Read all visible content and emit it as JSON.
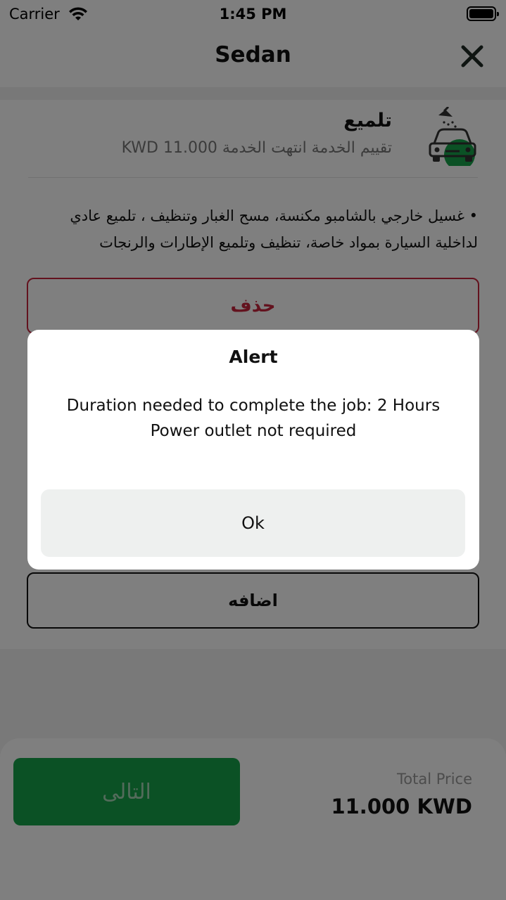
{
  "status_bar": {
    "carrier": "Carrier",
    "time": "1:45 PM"
  },
  "nav": {
    "title": "Sedan",
    "close_icon": "close-icon"
  },
  "service": {
    "name": "تلميع",
    "meta": "تقييم الخدمة انتهت الخدمة KWD 11.000",
    "icon": "car-wash-icon",
    "description": "• غسيل خارجي بالشامبو مكنسة، مسح الغبار وتنظيف ، تلميع عادي لداخلية السيارة بمواد خاصة، تنظيف وتلميع الإطارات والرنجات",
    "delete_label": "حذف"
  },
  "add_label": "اضافه",
  "footer": {
    "next_label": "التالى",
    "total_label": "Total Price",
    "total_value": "11.000 KWD"
  },
  "alert": {
    "title": "Alert",
    "line1": "Duration needed to complete the job: 2 Hours",
    "line2": "Power outlet not required",
    "ok_label": "Ok"
  },
  "colors": {
    "primary_green": "#17a34a",
    "danger_red": "#c6243c",
    "overlay": "rgba(0,0,0,0.5)"
  }
}
